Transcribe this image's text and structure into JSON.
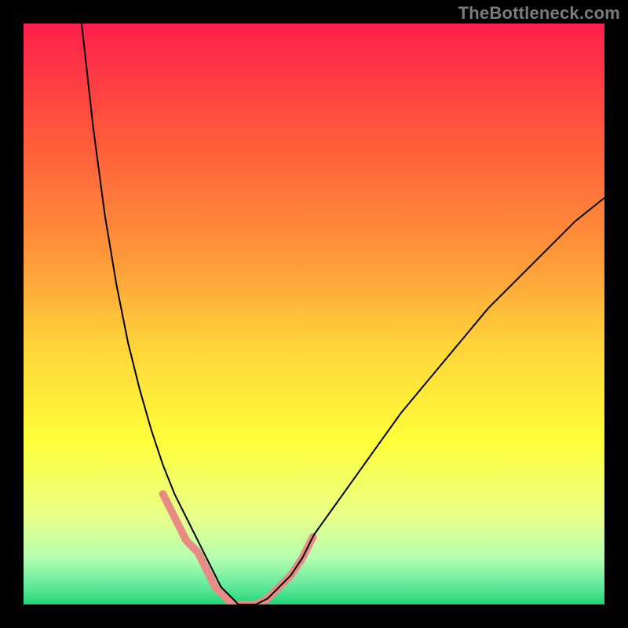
{
  "watermark": "TheBottleneck.com",
  "chart_data": {
    "type": "line",
    "title": "",
    "xlabel": "",
    "ylabel": "",
    "xlim": [
      0,
      100
    ],
    "ylim": [
      0,
      100
    ],
    "background_gradient": {
      "orientation": "vertical",
      "stops": [
        {
          "pos": 0.0,
          "color": "#ff1f4d"
        },
        {
          "pos": 0.2,
          "color": "#ff5a3a"
        },
        {
          "pos": 0.4,
          "color": "#ff973a"
        },
        {
          "pos": 0.55,
          "color": "#ffd23a"
        },
        {
          "pos": 0.72,
          "color": "#ffff3a"
        },
        {
          "pos": 0.85,
          "color": "#e8ff8a"
        },
        {
          "pos": 0.92,
          "color": "#b4ffb0"
        },
        {
          "pos": 0.97,
          "color": "#5fe89a"
        },
        {
          "pos": 1.0,
          "color": "#22d477"
        }
      ]
    },
    "series": [
      {
        "name": "curve",
        "color": "#000000",
        "x": [
          10,
          12,
          14,
          16,
          18,
          20,
          22,
          24,
          26,
          28,
          30,
          31,
          32,
          33,
          34,
          35,
          36,
          37,
          38,
          39,
          40,
          42,
          44,
          46,
          48,
          50,
          55,
          60,
          65,
          70,
          75,
          80,
          85,
          90,
          95,
          100
        ],
        "y": [
          100,
          82,
          67,
          55,
          45,
          37,
          30,
          24,
          19,
          15,
          11,
          9,
          7,
          5,
          3,
          2,
          1,
          0,
          0,
          0,
          0,
          1,
          3,
          5,
          8,
          12,
          19,
          26,
          33,
          39,
          45,
          51,
          56,
          61,
          66,
          70
        ]
      }
    ],
    "highlight_segments": [
      {
        "color": "#e88b85",
        "width": 10,
        "x": [
          24,
          26,
          28,
          30,
          31,
          32,
          33,
          34,
          35,
          36,
          37,
          38
        ],
        "y": [
          19,
          15,
          11,
          9,
          7,
          5,
          3,
          2,
          1,
          0,
          0,
          0
        ]
      },
      {
        "color": "#e88b85",
        "width": 10,
        "x": [
          38,
          39,
          40,
          42,
          44,
          46,
          48,
          50
        ],
        "y": [
          0,
          0,
          0,
          1,
          3,
          5,
          8,
          12
        ]
      }
    ]
  }
}
